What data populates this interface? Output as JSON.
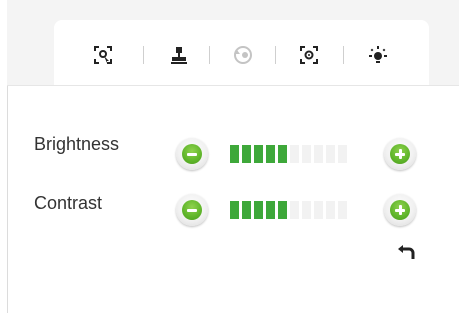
{
  "toolbar": {
    "items": [
      {
        "icon": "focus-area-icon"
      },
      {
        "icon": "stamp-icon"
      },
      {
        "icon": "rotate-icon"
      },
      {
        "icon": "exposure-target-icon"
      },
      {
        "icon": "brightness-icon"
      }
    ],
    "active_index": 4
  },
  "adjustments": {
    "brightness": {
      "label": "Brightness",
      "level": 5,
      "max": 10
    },
    "contrast": {
      "label": "Contrast",
      "level": 5,
      "max": 10
    }
  },
  "colors": {
    "accent_green": "#3ea83a",
    "button_green": "#5fb52a",
    "segment_off": "#f2f2f2",
    "icon_dark": "#222222",
    "icon_disabled": "#b8b8b8"
  }
}
